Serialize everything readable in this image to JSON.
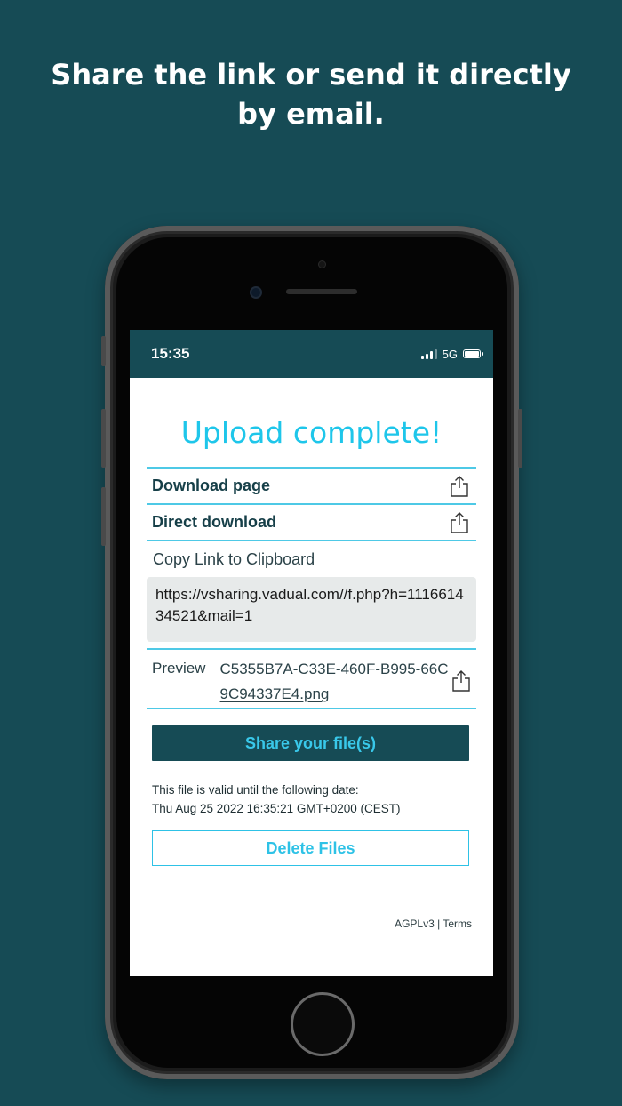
{
  "headline": "Share the link or send it directly by email.",
  "status_bar": {
    "time": "15:35",
    "network": "5G"
  },
  "screen": {
    "title": "Upload complete!",
    "links": [
      {
        "label": "Download page",
        "icon": "share-icon"
      },
      {
        "label": "Direct download",
        "icon": "share-icon"
      }
    ],
    "copy_label": "Copy Link to Clipboard",
    "url": "https://vsharing.vadual.com//f.php?h=111661434521&mail=1",
    "preview_label": "Preview",
    "preview_file": "C5355B7A-C33E-460F-B995-66C9C94337E4.png",
    "share_button": "Share your file(s)",
    "valid_line1": "This file is valid until the following date:",
    "valid_line2": "Thu Aug 25 2022 16:35:21 GMT+0200 (CEST)",
    "delete_button": "Delete Files",
    "footer": "AGPLv3 | Terms"
  },
  "colors": {
    "background": "#164b55",
    "accent": "#1ec6ea",
    "divider": "#4ec9e6",
    "url_box": "#e7eaea"
  }
}
